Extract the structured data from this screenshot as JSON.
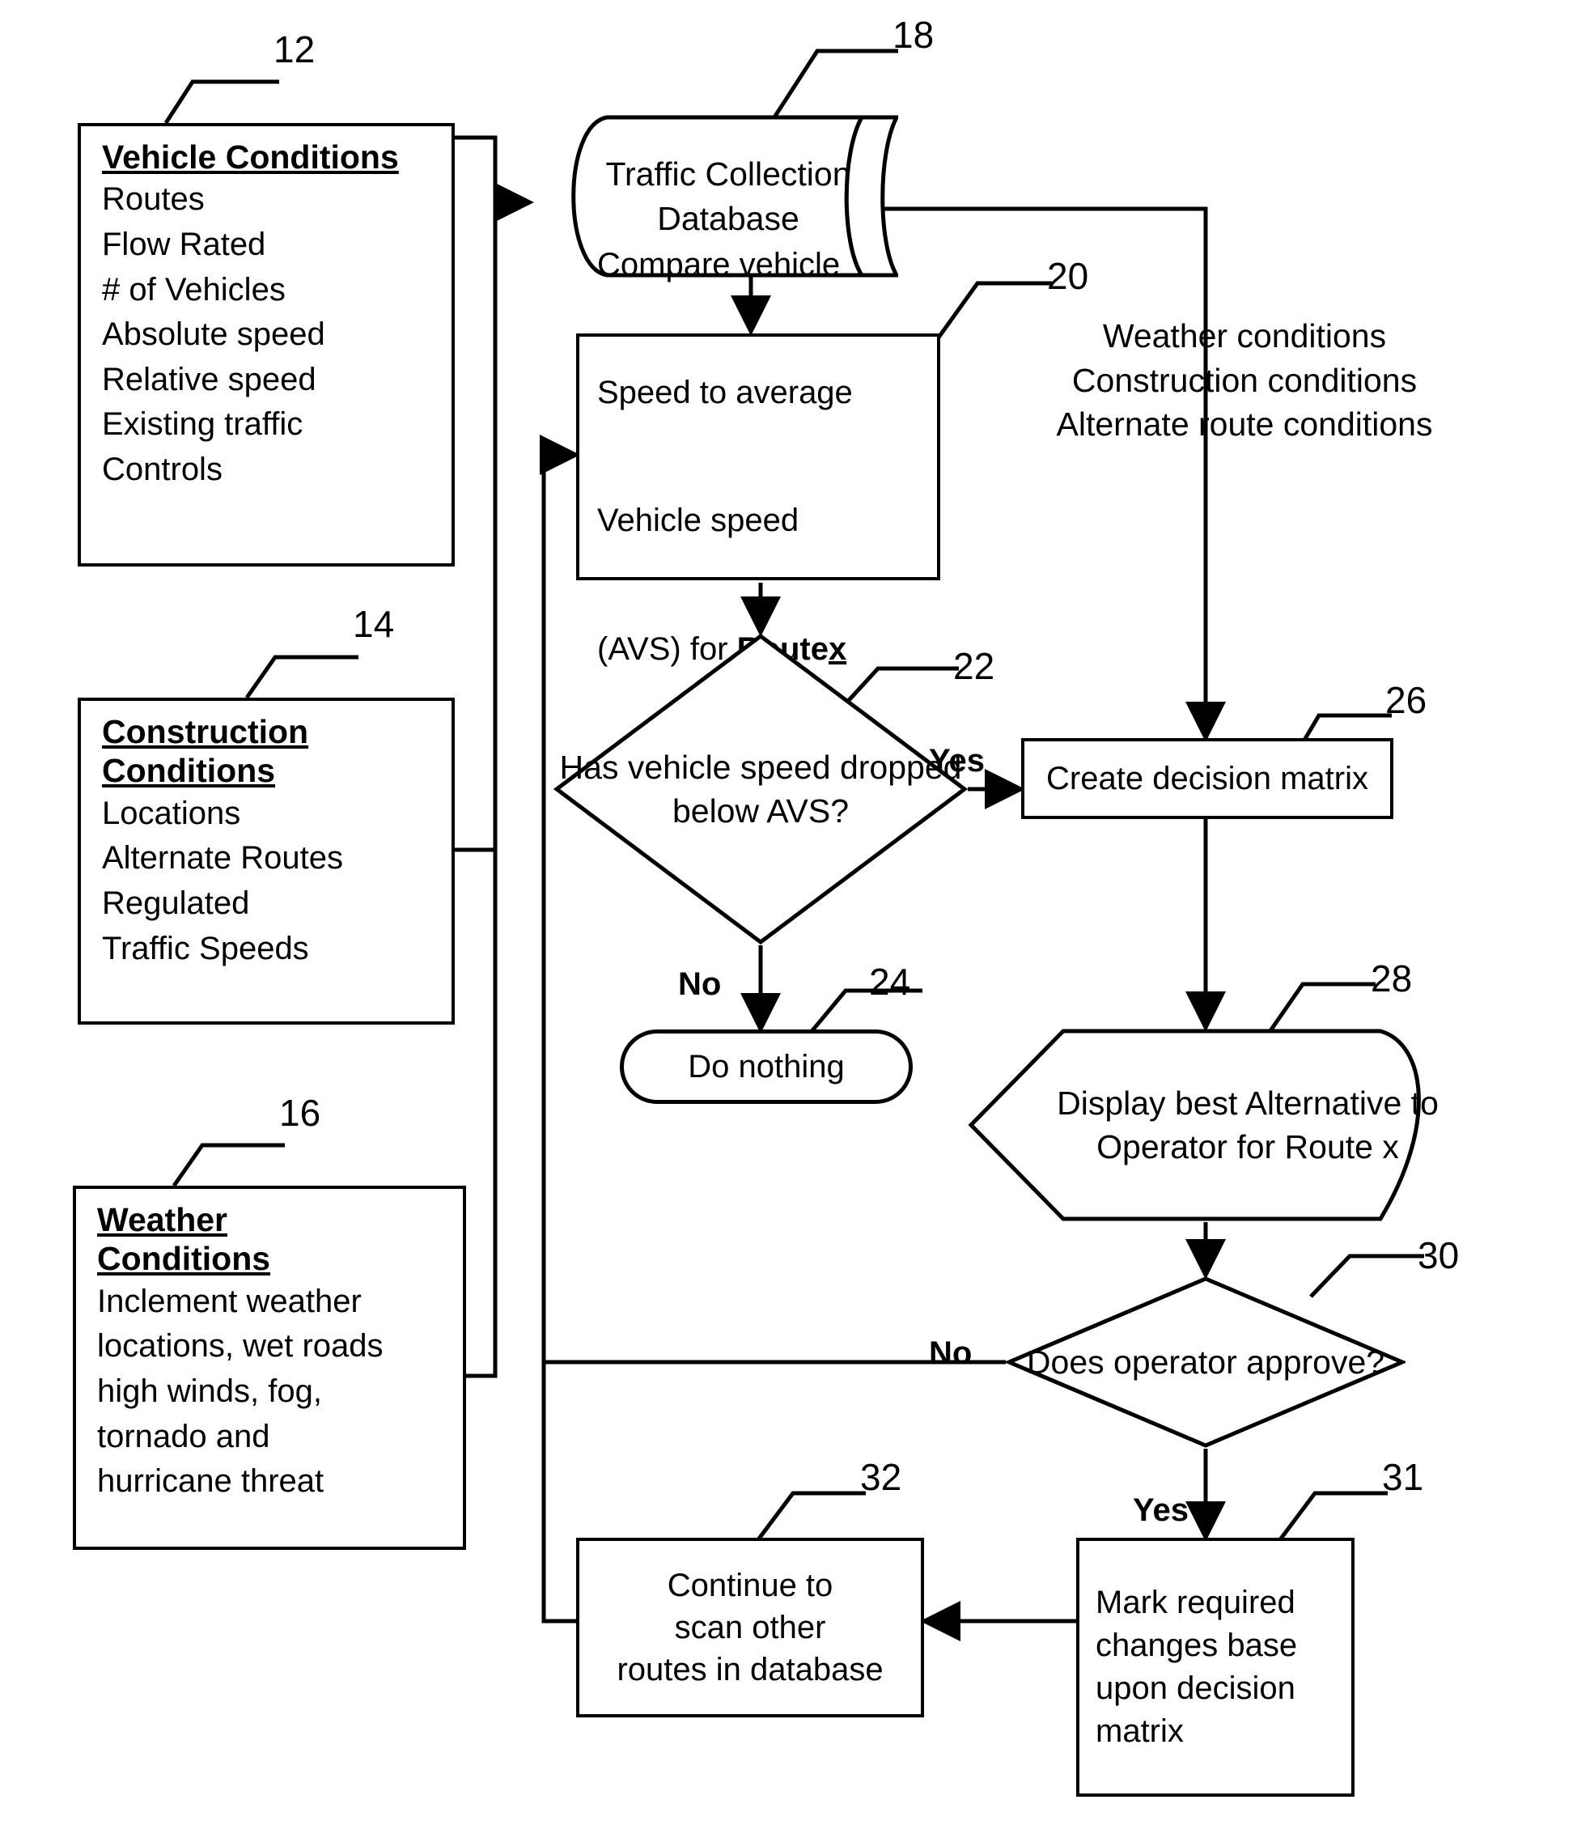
{
  "figure": {
    "type": "patent-flowchart",
    "title": "Traffic route decision flowchart"
  },
  "input_blocks": [
    {
      "ref": "12",
      "name": "vehicle-conditions",
      "heading_lines": [
        "Vehicle Conditions"
      ],
      "items": [
        "Routes",
        "Flow Rated",
        "# of Vehicles",
        "Absolute speed",
        "Relative speed",
        "Existing traffic",
        "Controls"
      ]
    },
    {
      "ref": "14",
      "name": "construction-conditions",
      "heading_lines": [
        "Construction",
        "Conditions"
      ],
      "items": [
        "Locations",
        "Alternate Routes",
        "Regulated",
        "Traffic Speeds"
      ]
    },
    {
      "ref": "16",
      "name": "weather-conditions",
      "heading_lines": [
        "Weather",
        "Conditions"
      ],
      "items": [
        "Inclement weather",
        "locations, wet roads",
        "high winds, fog,",
        "tornado and",
        "hurricane threat"
      ]
    }
  ],
  "nodes": {
    "database": {
      "ref": "18",
      "text": "Traffic\nCollection\nDatabase"
    },
    "compare": {
      "ref": "20",
      "line1": "Compare vehicle",
      "line2": "Speed to average",
      "line3": "Vehicle speed",
      "line4a": "(AVS) for ",
      "line4b": "Route",
      "line4c": "x"
    },
    "decision_avs": {
      "ref": "22",
      "text": "Has vehicle\nspeed dropped\nbelow AVS?"
    },
    "do_nothing": {
      "ref": "24",
      "text": "Do nothing"
    },
    "create_matrix": {
      "ref": "26",
      "text": "Create decision matrix"
    },
    "display_best": {
      "ref": "28",
      "text": "Display best\nAlternative to\nOperator for Route x"
    },
    "decision_approve": {
      "ref": "30",
      "text": "Does operator\napprove?"
    },
    "mark_changes": {
      "ref": "31",
      "text": "Mark required\nchanges base\nupon decision\nmatrix"
    },
    "continue_scan": {
      "ref": "32",
      "text": "Continue to\nscan other\nroutes in database"
    }
  },
  "side_conditions": {
    "name": "external-conditions-list",
    "lines": [
      "Weather conditions",
      "Construction conditions",
      "Alternate route conditions"
    ]
  },
  "edge_labels": {
    "avs_yes": "Yes",
    "avs_no": "No",
    "approve_no": "No",
    "approve_yes": "Yes"
  },
  "reference_numerals": [
    "12",
    "14",
    "16",
    "18",
    "20",
    "22",
    "24",
    "26",
    "28",
    "30",
    "31",
    "32"
  ],
  "colors": {
    "ink": "#000000",
    "paper": "#ffffff"
  }
}
